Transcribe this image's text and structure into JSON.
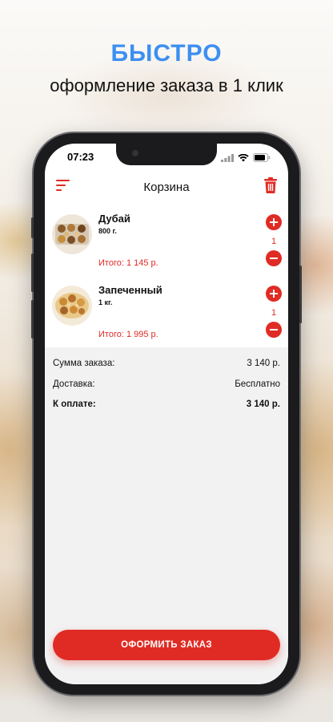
{
  "promo": {
    "headline": "БЫСТРО",
    "subline": "оформление заказа в 1 клик"
  },
  "status_bar": {
    "time": "07:23",
    "icons": [
      "signal-icon",
      "wifi-icon",
      "battery-icon"
    ]
  },
  "header": {
    "title": "Корзина",
    "menu_icon": "menu-lines-icon",
    "trash_icon": "trash-icon"
  },
  "cart": {
    "items": [
      {
        "name": "Дубай",
        "weight": "800 г.",
        "total": "Итого: 1 145 р.",
        "quantity": "1"
      },
      {
        "name": "Запеченный",
        "weight": "1 кг.",
        "total": "Итого: 1 995 р.",
        "quantity": "1"
      }
    ]
  },
  "summary": {
    "subtotal_label": "Сумма заказа:",
    "subtotal_value": "3 140 р.",
    "delivery_label": "Доставка:",
    "delivery_value": "Бесплатно",
    "payable_label": "К оплате:",
    "payable_value": "3 140 р."
  },
  "checkout": {
    "button_label": "ОФОРМИТЬ ЗАКАЗ"
  },
  "colors": {
    "accent": "#e02b24",
    "headline": "#3d8ff1"
  }
}
